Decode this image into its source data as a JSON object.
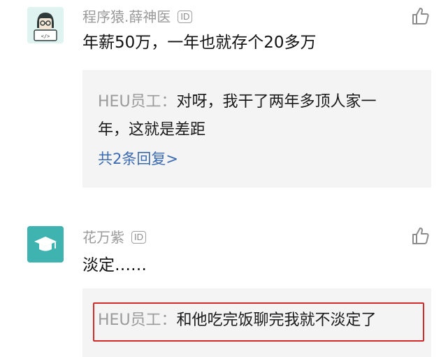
{
  "comments": [
    {
      "username": "程序猿.薛神医",
      "id_badge": "ID",
      "text": "年薪50万，一年也就存个20多万",
      "reply": {
        "author": "HEU员工：",
        "text_line1": "对呀，我干了两年多顶人家一",
        "text_line2": "年，这就是差距",
        "more_link": "共2条回复>"
      }
    },
    {
      "username": "花万紫",
      "id_badge": "ID",
      "text": "淡定……",
      "reply": {
        "author": "HEU员工：",
        "text_line1": "和他吃完饭聊完我就不淡定了"
      }
    }
  ],
  "icons": {
    "avatar1": "coder-avatar-icon",
    "avatar2": "graduation-cap-icon",
    "like": "thumbs-up-icon"
  },
  "colors": {
    "avatar1_bg": "#dff3f1",
    "avatar2_bg": "#3fb3b0",
    "link": "#3a6ab0",
    "highlight": "#d32a2a",
    "reply_bg": "#f4f4f4"
  }
}
